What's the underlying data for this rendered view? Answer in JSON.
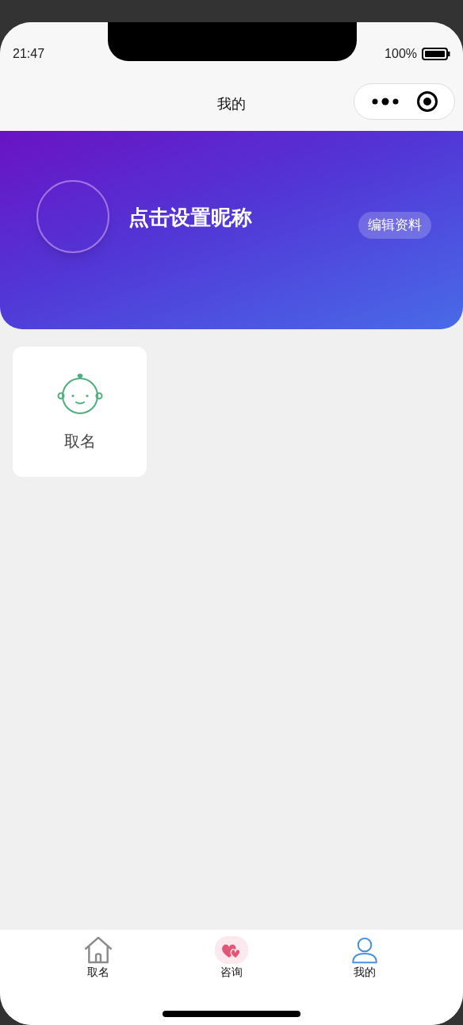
{
  "status_bar": {
    "time": "21:47",
    "battery": "100%"
  },
  "nav": {
    "title": "我的"
  },
  "profile": {
    "nickname": "点击设置昵称",
    "edit_button": "编辑资料"
  },
  "grid": [
    {
      "kind": "baby",
      "label": "取名"
    }
  ],
  "tab_bar": [
    {
      "kind": "home",
      "label": "取名",
      "selected": false
    },
    {
      "kind": "hearts",
      "label": "咨询",
      "selected": false
    },
    {
      "kind": "person",
      "label": "我的",
      "selected": true
    }
  ]
}
